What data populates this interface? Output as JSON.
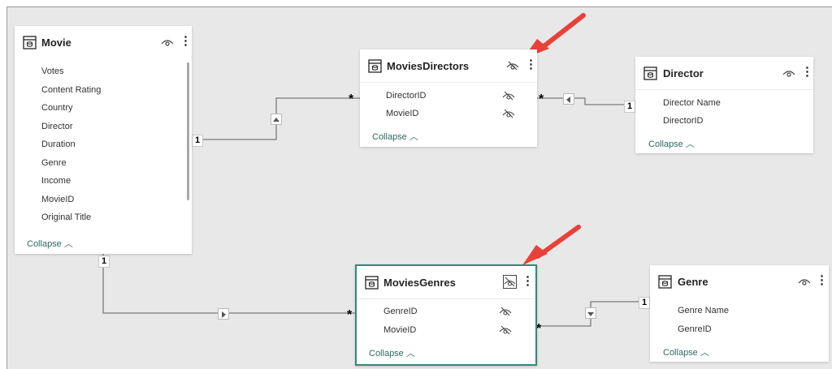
{
  "colors": {
    "accent": "#2e8b78",
    "arrow": "#e8413a"
  },
  "tables": {
    "movie": {
      "title": "Movie",
      "fields": [
        "Votes",
        "Content Rating",
        "Country",
        "Director",
        "Duration",
        "Genre",
        "Income",
        "MovieID",
        "Original Title"
      ],
      "collapse": "Collapse",
      "icon": "eye-icon"
    },
    "moviesdirectors": {
      "title": "MoviesDirectors",
      "fields": [
        "DirectorID",
        "MovieID"
      ],
      "collapse": "Collapse",
      "icon": "eye-off-icon"
    },
    "director": {
      "title": "Director",
      "fields": [
        "Director Name",
        "DirectorID"
      ],
      "collapse": "Collapse",
      "icon": "eye-icon"
    },
    "moviesgenres": {
      "title": "MoviesGenres",
      "fields": [
        "GenreID",
        "MovieID"
      ],
      "collapse": "Collapse",
      "icon": "eye-off-boxed-icon"
    },
    "genre": {
      "title": "Genre",
      "fields": [
        "Genre Name",
        "GenreID"
      ],
      "collapse": "Collapse",
      "icon": "eye-icon"
    }
  },
  "relationships": {
    "one": "1",
    "many": "*"
  }
}
